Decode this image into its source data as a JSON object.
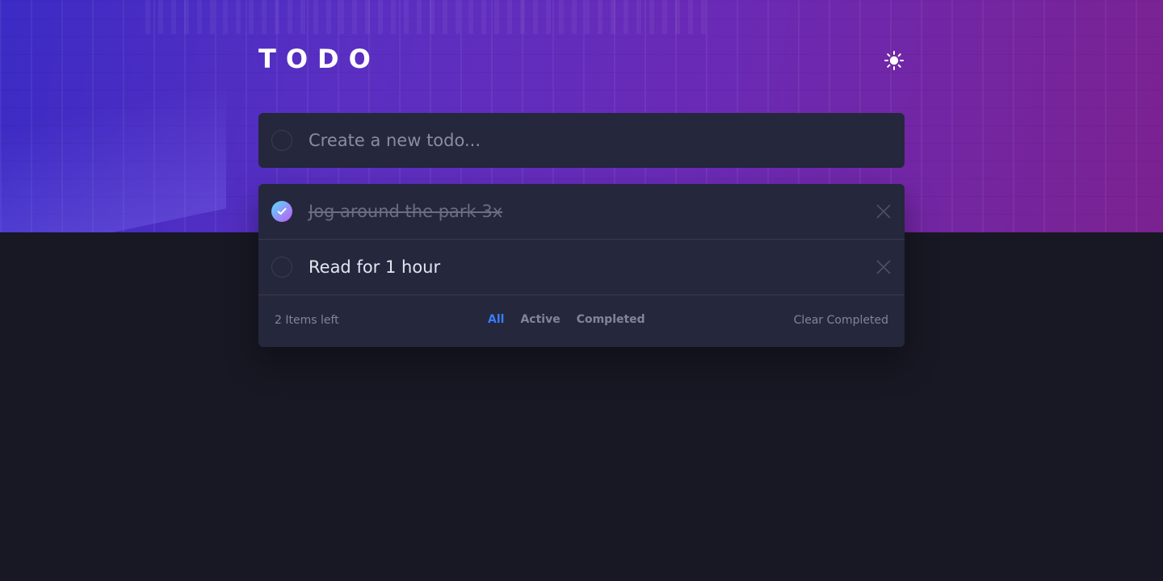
{
  "app": {
    "title": "TODO"
  },
  "theme_toggle": {
    "icon": "sun-icon"
  },
  "create": {
    "placeholder": "Create a new todo..."
  },
  "todos": [
    {
      "text": "Jog around the park 3x",
      "completed": true
    },
    {
      "text": "Read for 1 hour",
      "completed": false
    }
  ],
  "footer": {
    "items_left": "2 Items left",
    "filters": {
      "all": "All",
      "active": "Active",
      "completed": "Completed"
    },
    "active_filter": "All",
    "clear_label": "Clear Completed"
  },
  "colors": {
    "accent": "#3a7cfd",
    "card": "#25273c",
    "background": "#181824",
    "check_gradient_start": "#57ddff",
    "check_gradient_end": "#c058f3"
  }
}
